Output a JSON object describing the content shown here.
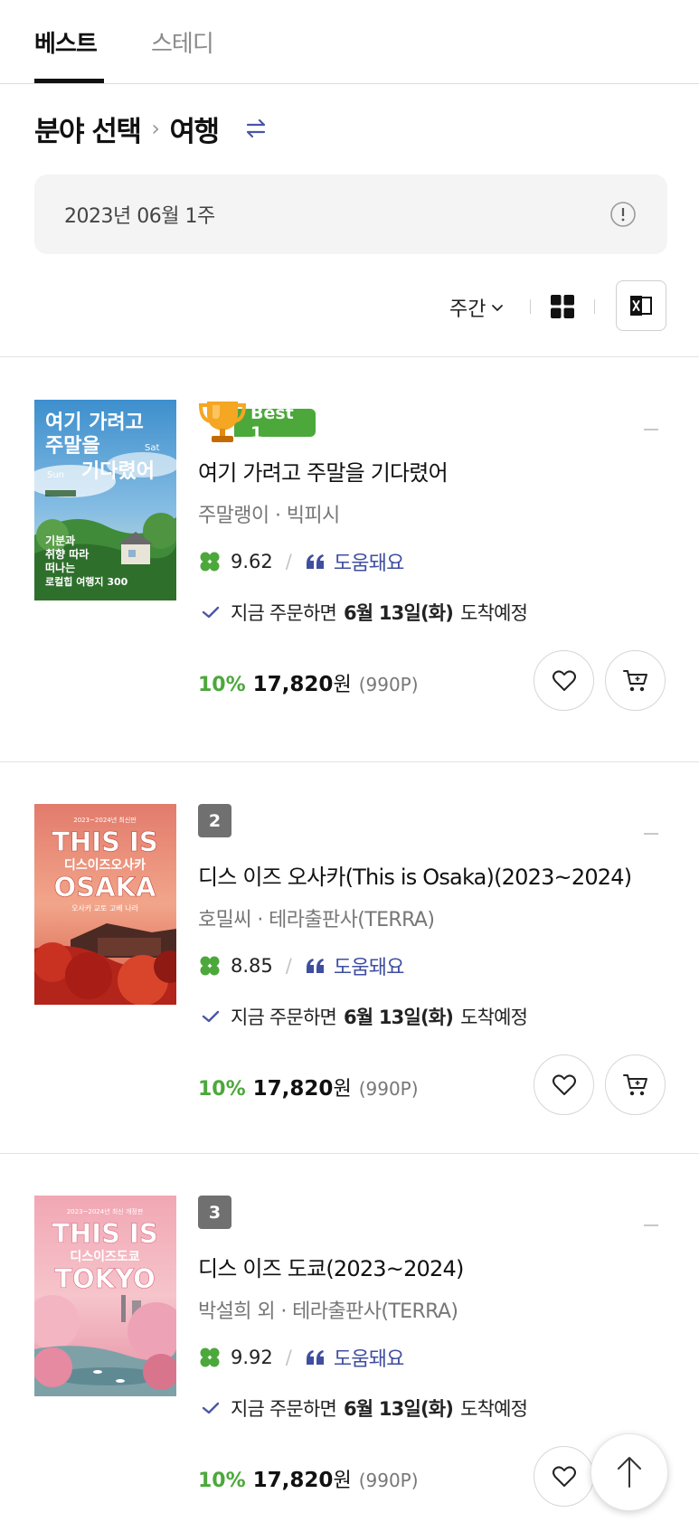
{
  "tabs": [
    {
      "label": "베스트",
      "active": true
    },
    {
      "label": "스테디",
      "active": false
    }
  ],
  "breadcrumb": {
    "root": "분야 선택",
    "current": "여행"
  },
  "date_label": "2023년 06월 1주",
  "toolbar": {
    "period_label": "주간"
  },
  "colors": {
    "accent_green": "#4ca83b",
    "helpful_blue": "#3f4ea0",
    "swap_icon": "#4a56a6"
  },
  "books": [
    {
      "rank": "1",
      "badge": "Best 1",
      "title": "여기 가려고 주말을 기다렸어",
      "author_publisher": "주말랭이 · 빅피시",
      "rating": "9.62",
      "helpful_label": "도움돼요",
      "delivery_prefix": "지금 주문하면",
      "delivery_date": "6월 13일(화)",
      "delivery_suffix": "도착예정",
      "discount": "10%",
      "price": "17,820",
      "currency": "원",
      "points": "(990P)",
      "cover": {
        "line1": "여기 가려고",
        "line2": "주말을",
        "line3": "기다렸어",
        "sub1": "기분과",
        "sub2": "취향 따라",
        "sub3": "떠나는",
        "sub4": "로컬힙 여행지 300",
        "tag_sun": "Sun",
        "tag_sat": "Sat"
      }
    },
    {
      "rank": "2",
      "title": "디스 이즈 오사카(This is Osaka)(2023~2024)",
      "author_publisher": "호밀씨 · 테라출판사(TERRA)",
      "rating": "8.85",
      "helpful_label": "도움돼요",
      "delivery_prefix": "지금 주문하면",
      "delivery_date": "6월 13일(화)",
      "delivery_suffix": "도착예정",
      "discount": "10%",
      "price": "17,820",
      "currency": "원",
      "points": "(990P)",
      "cover": {
        "top": "2023~2024년 최신판",
        "line1": "THIS IS",
        "line2": "디스이즈오사카",
        "line3": "OSAKA",
        "line4": "오사카 교토 고베 나라"
      }
    },
    {
      "rank": "3",
      "title": "디스 이즈 도쿄(2023~2024)",
      "author_publisher": "박설희 외 · 테라출판사(TERRA)",
      "rating": "9.92",
      "helpful_label": "도움돼요",
      "delivery_prefix": "지금 주문하면",
      "delivery_date": "6월 13일(화)",
      "delivery_suffix": "도착예정",
      "discount": "10%",
      "price": "17,820",
      "currency": "원",
      "points": "(990P)",
      "cover": {
        "top": "2023~2024년 최신 개정판",
        "line1": "THIS IS",
        "line2": "디스이즈도쿄",
        "line3": "TOKYO"
      }
    }
  ]
}
